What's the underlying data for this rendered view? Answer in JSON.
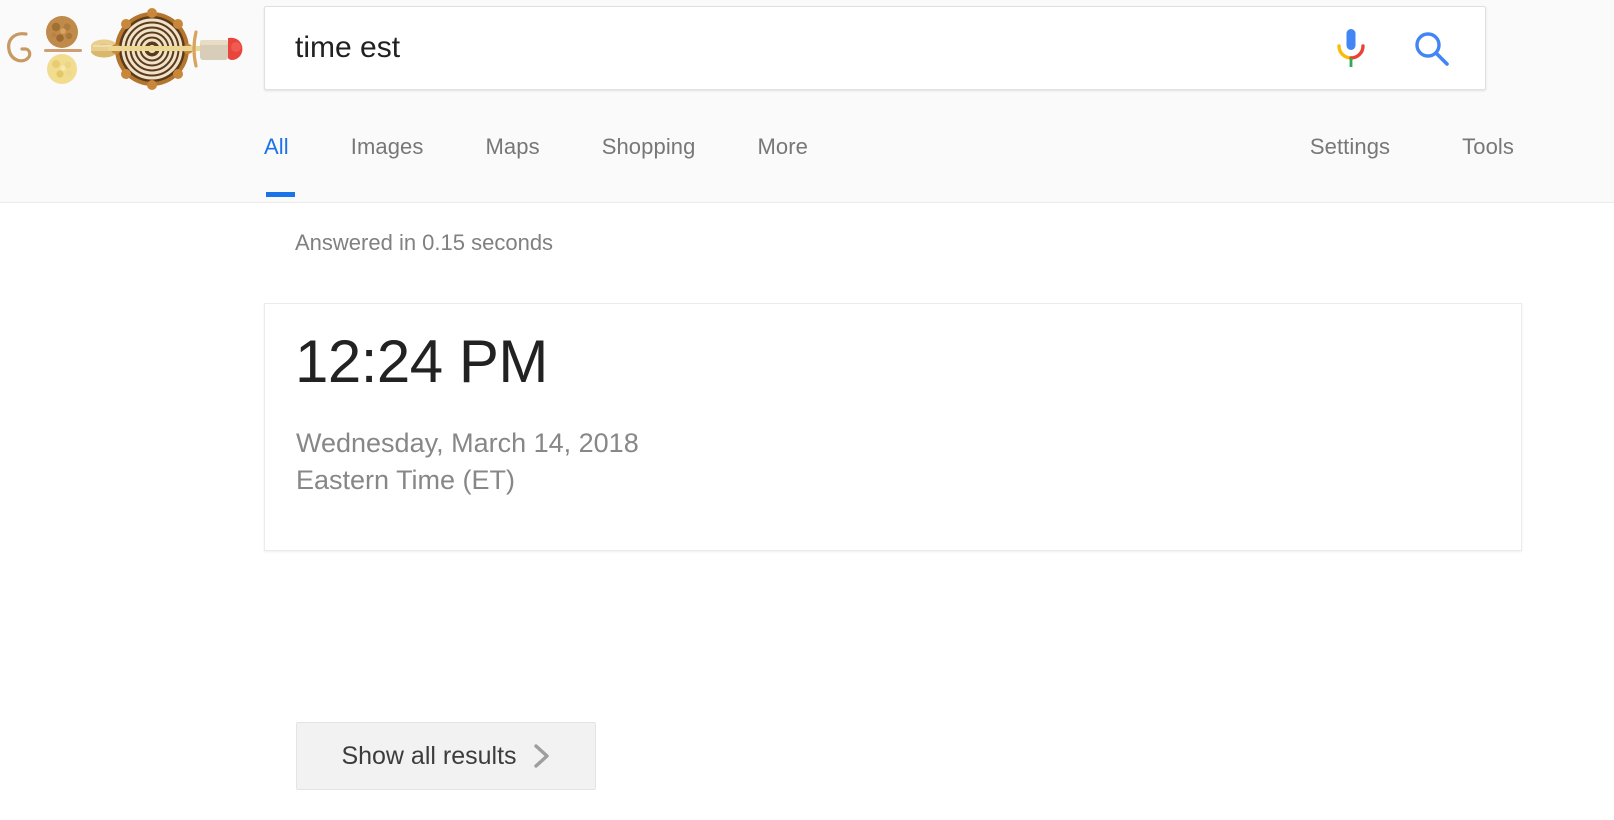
{
  "header": {
    "doodle": {
      "name": "google-pi-day-doodle",
      "alt": "Google Doodle made of pies and pastries",
      "theme": "Pi Day 2018"
    },
    "search": {
      "value": "time est",
      "placeholder": "Search",
      "mic_icon": "microphone-icon",
      "search_icon": "search-icon"
    },
    "nav_tabs": [
      {
        "label": "All",
        "active": true
      },
      {
        "label": "Images",
        "active": false
      },
      {
        "label": "Maps",
        "active": false
      },
      {
        "label": "Shopping",
        "active": false
      },
      {
        "label": "More",
        "active": false
      }
    ],
    "nav_right": [
      {
        "label": "Settings"
      },
      {
        "label": "Tools"
      }
    ]
  },
  "main": {
    "result_stats": "Answered in 0.15 seconds",
    "answer_card": {
      "time": "12:24 PM",
      "date": "Wednesday, March 14, 2018",
      "timezone": "Eastern Time (ET)"
    },
    "show_all_button": {
      "label": "Show all results",
      "icon": "chevron-right-icon"
    }
  },
  "colors": {
    "accent_blue": "#1a73e8",
    "google_red": "#ea4335",
    "google_yellow": "#fbbc05",
    "google_green": "#34a853",
    "text_primary": "#222222",
    "text_secondary": "#878787",
    "header_bg": "#fafafa",
    "button_bg": "#f2f2f2"
  }
}
